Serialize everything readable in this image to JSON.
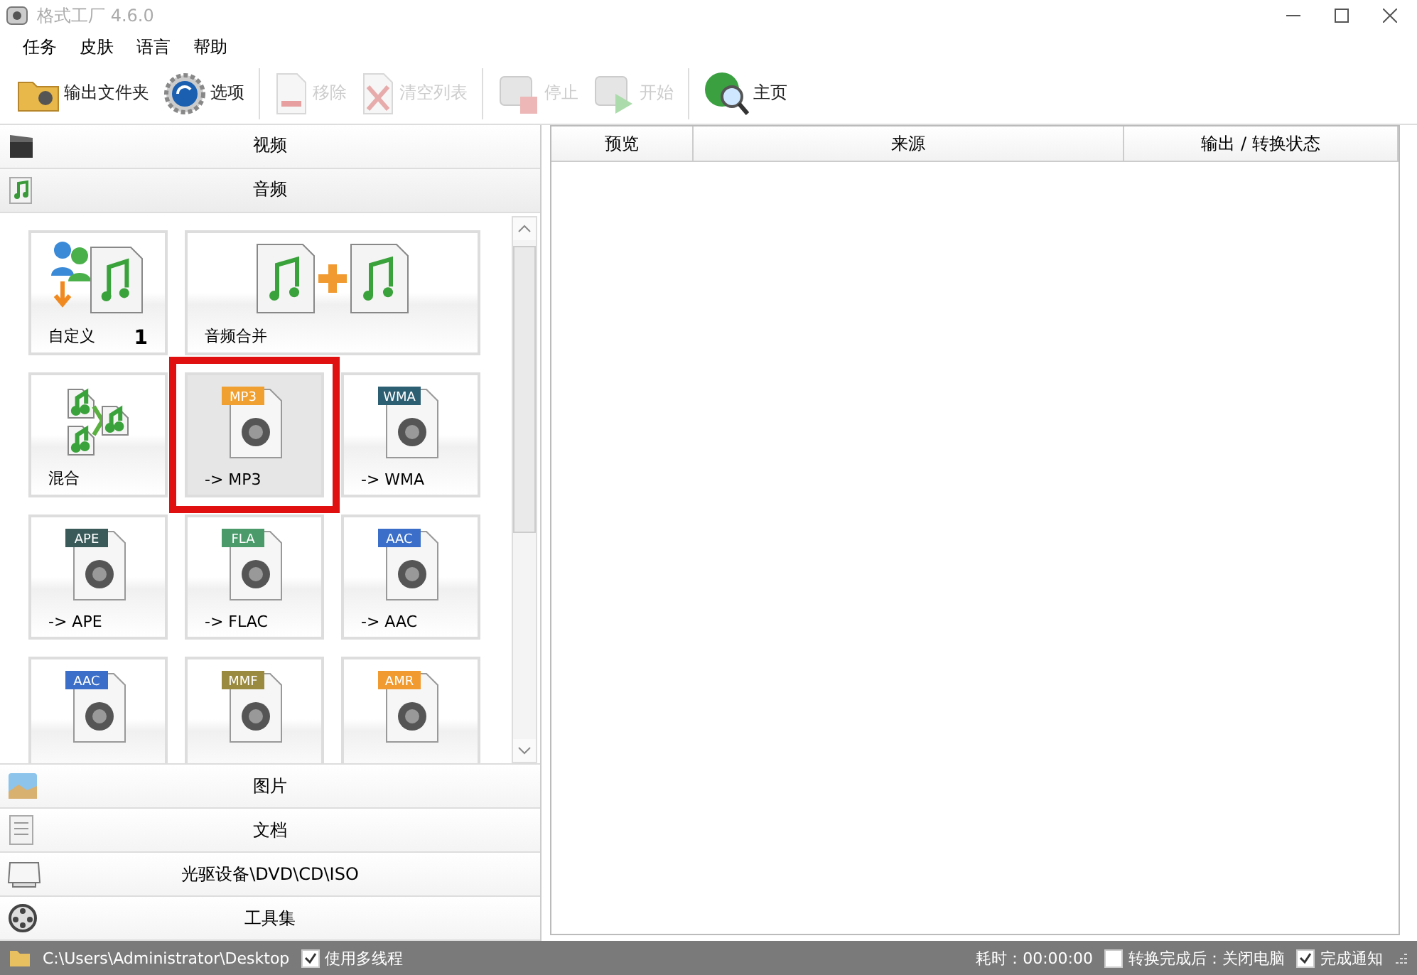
{
  "window": {
    "title": "格式工厂 4.6.0"
  },
  "menu": [
    "任务",
    "皮肤",
    "语言",
    "帮助"
  ],
  "toolbar": [
    {
      "kind": "folder",
      "label": "输出文件夹",
      "disabled": false
    },
    {
      "kind": "gear",
      "label": "选项",
      "disabled": false
    },
    {
      "kind": "separator"
    },
    {
      "kind": "remove",
      "label": "移除",
      "disabled": true
    },
    {
      "kind": "clear",
      "label": "清空列表",
      "disabled": true
    },
    {
      "kind": "separator"
    },
    {
      "kind": "stop",
      "label": "停止",
      "disabled": true
    },
    {
      "kind": "start",
      "label": "开始",
      "disabled": true
    },
    {
      "kind": "separator"
    },
    {
      "kind": "home",
      "label": "主页",
      "disabled": false
    }
  ],
  "categories": [
    {
      "kind": "video",
      "label": "视频",
      "expanded": false
    },
    {
      "kind": "audio",
      "label": "音频",
      "expanded": true
    },
    {
      "kind": "image",
      "label": "图片",
      "expanded": false
    },
    {
      "kind": "document",
      "label": "文档",
      "expanded": false
    },
    {
      "kind": "disc",
      "label": "光驱设备\\DVD\\CD\\ISO",
      "expanded": false
    },
    {
      "kind": "tools",
      "label": "工具集",
      "expanded": false
    }
  ],
  "tiles": [
    {
      "kind": "custom",
      "label": "自定义",
      "count": "1",
      "selected": false,
      "highlighted": false
    },
    {
      "kind": "merge",
      "label": "音频合并",
      "selected": false,
      "highlighted": false
    },
    {
      "kind": "mix",
      "label": "混合",
      "selected": false,
      "highlighted": false
    },
    {
      "kind": "format",
      "badge": "MP3",
      "color": "#f0a030",
      "label": "-> MP3",
      "selected": true,
      "highlighted": true
    },
    {
      "kind": "format",
      "badge": "WMA",
      "color": "#2d5f73",
      "label": "-> WMA",
      "selected": false,
      "highlighted": false
    },
    {
      "kind": "format",
      "badge": "APE",
      "color": "#3a5a5a",
      "label": "-> APE",
      "selected": false,
      "highlighted": false
    },
    {
      "kind": "format",
      "badge": "FLA",
      "color": "#4a9a6a",
      "label": "-> FLAC",
      "selected": false,
      "highlighted": false
    },
    {
      "kind": "format",
      "badge": "AAC",
      "color": "#3a6ec8",
      "label": "-> AAC",
      "selected": false,
      "highlighted": false
    },
    {
      "kind": "format",
      "badge": "AAC",
      "color": "#3a6ec8",
      "selected": false,
      "highlighted": false
    },
    {
      "kind": "format",
      "badge": "MMF",
      "color": "#9a8a40",
      "selected": false,
      "highlighted": false
    },
    {
      "kind": "format",
      "badge": "AMR",
      "color": "#f09a30",
      "selected": false,
      "highlighted": false
    }
  ],
  "table": {
    "columns": [
      "预览",
      "来源",
      "输出 / 转换状态"
    ]
  },
  "status_bar": {
    "path": "C:\\Users\\Administrator\\Desktop",
    "multithread": {
      "label": "使用多线程",
      "checked": true
    },
    "elapsed": "耗时：00:00:00",
    "shutdown": {
      "label": "转换完成后：关闭电脑",
      "checked": false
    },
    "notify": {
      "label": "完成通知",
      "checked": true
    }
  }
}
